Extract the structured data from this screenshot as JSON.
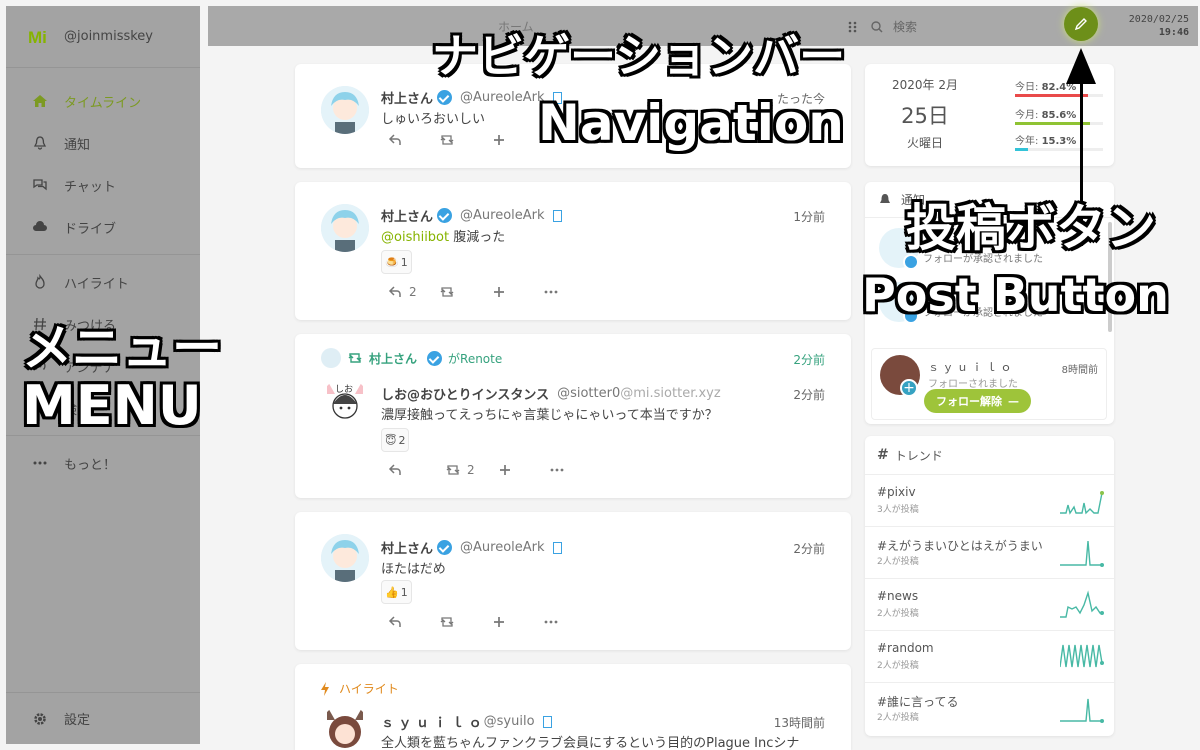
{
  "sidebar": {
    "account": "@joinmisskey",
    "items": [
      {
        "label": "タイムライン",
        "icon": "home-icon"
      },
      {
        "label": "通知",
        "icon": "bell-icon"
      },
      {
        "label": "チャット",
        "icon": "chat-icon"
      },
      {
        "label": "ドライブ",
        "icon": "cloud-icon"
      }
    ],
    "items2": [
      {
        "label": "ハイライト",
        "icon": "fire-icon"
      },
      {
        "label": "みつける",
        "icon": "hashtag-icon"
      },
      {
        "label": "アンテナ",
        "icon": "antenna-icon"
      },
      {
        "label": "検索",
        "icon": "search-icon"
      }
    ],
    "more": "もっと！",
    "settings": "設定"
  },
  "navbar": {
    "title": "ホーム",
    "search_placeholder": "検索",
    "date": "2020/02/25",
    "time": "19:46"
  },
  "notes": [
    {
      "name": "村上さん",
      "user": "@AureoleArk",
      "time": "たった今",
      "text": "しゅいろおいしい"
    },
    {
      "name": "村上さん",
      "user": "@AureoleArk",
      "time": "1分前",
      "mention": "@oishiibot",
      "text": "腹減った",
      "reaction": "🍮",
      "reaction_count": "1",
      "reply_count": "2"
    },
    {
      "renoter": "村上さん",
      "renote_suffix": "がRenote",
      "renote_time": "2分前",
      "name": "しお@おひとりインスタンス",
      "user": "@siotter0",
      "host": "@mi.siotter.xyz",
      "time": "2分前",
      "text": "濃厚接触ってえっちにゃ言葉じゃにゃいって本当ですか？",
      "reaction": "😇",
      "reaction_count": "2",
      "renote_count": "2"
    },
    {
      "name": "村上さん",
      "user": "@AureoleArk",
      "time": "2分前",
      "text": "ほたはだめ",
      "reaction": "👍",
      "reaction_count": "1"
    },
    {
      "highlight": "ハイライト",
      "name": "ｓ ｙ ｕ ｉ ｌ ｏ",
      "user": "@syuilo",
      "time": "13時間前",
      "text": "全人類を藍ちゃんファンクラブ会員にするという目的のPlague Incシナ"
    }
  ],
  "calendar": {
    "year_month": "2020年 2月",
    "day": "25日",
    "weekday": "火曜日",
    "bars": [
      {
        "label": "今日:",
        "value": "82.4%",
        "pct": 82.4,
        "color": "#e94a4a"
      },
      {
        "label": "今月:",
        "value": "85.6%",
        "pct": 85.6,
        "color": "#8fc333"
      },
      {
        "label": "今年:",
        "value": "15.3%",
        "pct": 15.3,
        "color": "#33c3d8"
      }
    ]
  },
  "notifications": {
    "title": "通知",
    "items": [
      {
        "text": "フォローが承認されました"
      },
      {
        "text": "フォローが承認されました"
      },
      {
        "name": "ｓ ｙ ｕ ｉ ｌ ｏ",
        "time": "8時間前",
        "text": "フォローされました",
        "button": "フォロー解除"
      }
    ]
  },
  "trends": {
    "title": "トレンド",
    "items": [
      {
        "tag": "#pixiv",
        "sub": "3人が投稿"
      },
      {
        "tag": "#えがうまいひとはえがうまい",
        "sub": "2人が投稿"
      },
      {
        "tag": "#news",
        "sub": "2人が投稿"
      },
      {
        "tag": "#random",
        "sub": "2人が投稿"
      },
      {
        "tag": "#誰に言ってる",
        "sub": "2人が投稿"
      }
    ]
  },
  "overlays": {
    "navbar_jp": "ナビゲーションバー",
    "navbar_en": "Navigation",
    "post_jp": "投稿ボタン",
    "post_en": "Post Button",
    "menu_jp": "メニュー",
    "menu_en": "MENU"
  }
}
